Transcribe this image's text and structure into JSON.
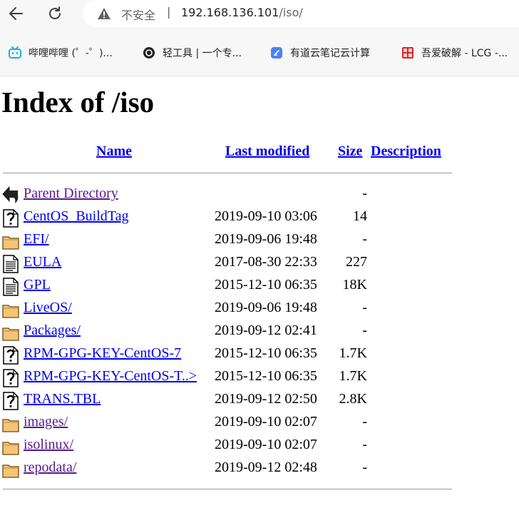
{
  "browser": {
    "security_label": "不安全",
    "separator": "|",
    "url_host": "192.168.136.101",
    "url_path": "/iso/"
  },
  "bookmarks": [
    {
      "label": "哔哩哔哩 (゜-゜)...",
      "icon": "bilibili-icon",
      "color": "#23ade5"
    },
    {
      "label": "轻工具 | 一个专...",
      "icon": "light-tool-icon",
      "color": "#222222"
    },
    {
      "label": "有道云笔记云计算",
      "icon": "youdao-note-icon",
      "color": "#4a82f7"
    },
    {
      "label": "吾爱破解 - LCG -...",
      "icon": "52pojie-icon",
      "color": "#d9262c"
    }
  ],
  "page": {
    "title": "Index of /iso",
    "columns": {
      "name": "Name",
      "last_modified": "Last modified",
      "size": "Size",
      "description": "Description"
    }
  },
  "entries": [
    {
      "icon": "back-arrow-icon",
      "name": "Parent Directory",
      "date": "",
      "size": "-",
      "visited": true
    },
    {
      "icon": "unknown-file-icon",
      "name": "CentOS_BuildTag",
      "date": "2019-09-10 03:06",
      "size": "14",
      "visited": false
    },
    {
      "icon": "folder-icon",
      "name": "EFI/",
      "date": "2019-09-06 19:48",
      "size": "-",
      "visited": false
    },
    {
      "icon": "text-file-icon",
      "name": "EULA",
      "date": "2017-08-30 22:33",
      "size": "227",
      "visited": false
    },
    {
      "icon": "text-file-icon",
      "name": "GPL",
      "date": "2015-12-10 06:35",
      "size": "18K",
      "visited": false
    },
    {
      "icon": "folder-icon",
      "name": "LiveOS/",
      "date": "2019-09-06 19:48",
      "size": "-",
      "visited": false
    },
    {
      "icon": "folder-icon",
      "name": "Packages/",
      "date": "2019-09-12 02:41",
      "size": "-",
      "visited": false
    },
    {
      "icon": "unknown-file-icon",
      "name": "RPM-GPG-KEY-CentOS-7",
      "date": "2015-12-10 06:35",
      "size": "1.7K",
      "visited": false
    },
    {
      "icon": "unknown-file-icon",
      "name": "RPM-GPG-KEY-CentOS-T..>",
      "date": "2015-12-10 06:35",
      "size": "1.7K",
      "visited": false
    },
    {
      "icon": "unknown-file-icon",
      "name": "TRANS.TBL",
      "date": "2019-09-12 02:50",
      "size": "2.8K",
      "visited": false
    },
    {
      "icon": "folder-icon",
      "name": "images/",
      "date": "2019-09-10 02:07",
      "size": "-",
      "visited": true
    },
    {
      "icon": "folder-icon",
      "name": "isolinux/",
      "date": "2019-09-10 02:07",
      "size": "-",
      "visited": true
    },
    {
      "icon": "folder-icon",
      "name": "repodata/",
      "date": "2019-09-12 02:48",
      "size": "-",
      "visited": true
    }
  ]
}
